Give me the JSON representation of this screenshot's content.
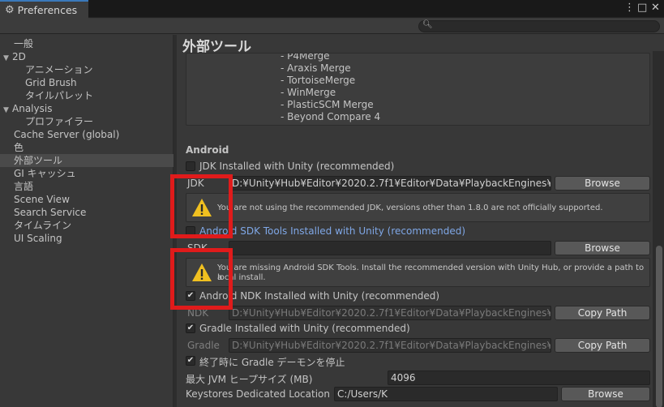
{
  "window": {
    "tab_title": "Preferences",
    "gear_icon": "gear-icon",
    "menu_icon": "⋮",
    "maximize_icon": "□",
    "close_icon": "✕"
  },
  "search": {
    "placeholder": ""
  },
  "sidebar": {
    "items": [
      {
        "label": "一般"
      },
      {
        "label": "2D"
      },
      {
        "label": "アニメーション"
      },
      {
        "label": "Grid Brush"
      },
      {
        "label": "タイルパレット"
      },
      {
        "label": "Analysis"
      },
      {
        "label": "プロファイラー"
      },
      {
        "label": "Cache Server (global)"
      },
      {
        "label": "色"
      },
      {
        "label": "外部ツール"
      },
      {
        "label": "GI キャッシュ"
      },
      {
        "label": "言語"
      },
      {
        "label": "Scene View"
      },
      {
        "label": "Search Service"
      },
      {
        "label": "タイムライン"
      },
      {
        "label": "UI Scaling"
      }
    ]
  },
  "main": {
    "title": "外部ツール",
    "merge_tools": [
      "- P4Merge",
      "- Araxis Merge",
      "- TortoiseMerge",
      "- WinMerge",
      "- PlasticSCM Merge",
      "- Beyond Compare 4"
    ],
    "android": {
      "section_title": "Android",
      "jdk_checkbox_label": "JDK Installed with Unity (recommended)",
      "jdk_label": "JDK",
      "jdk_path": "D:¥Unity¥Hub¥Editor¥2020.2.7f1¥Editor¥Data¥PlaybackEngines¥An",
      "jdk_browse": "Browse",
      "jdk_warning": "You are not using the recommended JDK, versions other than 1.8.0 are not officially supported.",
      "sdk_checkbox_label": "Android SDK Tools Installed with Unity (recommended)",
      "sdk_label": "SDK",
      "sdk_path": "",
      "sdk_browse": "Browse",
      "sdk_warning_line1": "You are missing Android SDK Tools. Install the recommended version with Unity Hub, or provide a path to a",
      "sdk_warning_line2": "local install.",
      "ndk_checkbox_label": "Android NDK Installed with Unity (recommended)",
      "ndk_checked": "✔",
      "ndk_label": "NDK",
      "ndk_path": "D:¥Unity¥Hub¥Editor¥2020.2.7f1¥Editor¥Data¥PlaybackEngines¥An",
      "ndk_copy": "Copy Path",
      "gradle_checkbox_label": "Gradle Installed with Unity (recommended)",
      "gradle_checked": "✔",
      "gradle_label": "Gradle",
      "gradle_path": "D:¥Unity¥Hub¥Editor¥2020.2.7f1¥Editor¥Data¥PlaybackEngines¥An",
      "gradle_copy": "Copy Path",
      "stop_daemon_label": "終了時に Gradle デーモンを停止",
      "stop_daemon_checked": "✔",
      "jvm_heap_label": "最大 JVM ヒープサイズ (MB)",
      "jvm_heap_value": "4096",
      "keystores_label": "Keystores Dedicated Location",
      "keystores_value": "C:/Users/K",
      "keystores_browse": "Browse"
    }
  },
  "colors": {
    "highlight": "#e01b1b",
    "warning": "#f0c020",
    "accent_tab": "#3a79bb"
  }
}
